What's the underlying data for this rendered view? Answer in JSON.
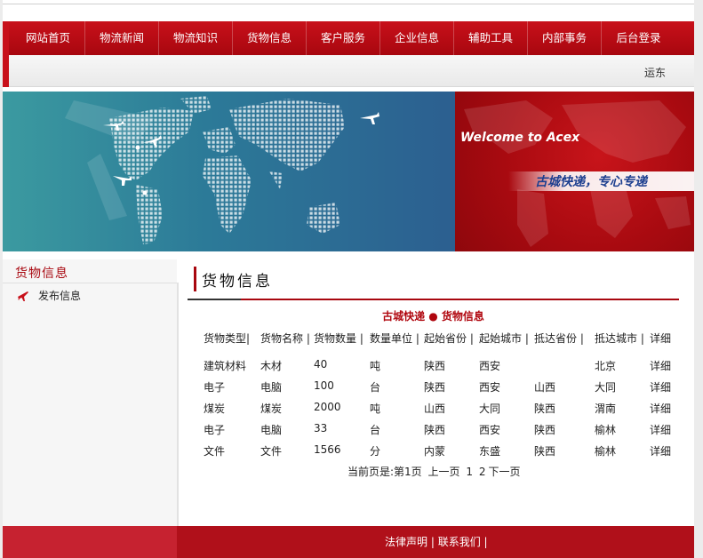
{
  "nav": {
    "items": [
      "网站首页",
      "物流新闻",
      "物流知识",
      "货物信息",
      "客户服务",
      "企业信息",
      "辅助工具",
      "内部事务",
      "后台登录"
    ]
  },
  "marquee": {
    "text": "运东"
  },
  "banner": {
    "welcome": "Welcome to  Acex",
    "slogan": "古城快递，专心专递"
  },
  "sidebar": {
    "title": "货物信息",
    "link": "发布信息"
  },
  "main": {
    "title": "货物信息",
    "caption": "古城快递 ● 货物信息",
    "headers": [
      "货物类型|",
      "货物名称 |",
      "货物数量 |",
      "数量单位 |",
      "起始省份 |",
      "起始城市 |",
      "抵达省份 |",
      "抵达城市 |",
      "详细"
    ],
    "rows": [
      [
        "建筑材料",
        "木材",
        "40",
        "吨",
        "陕西",
        "西安",
        "",
        "北京",
        "详细"
      ],
      [
        "电子",
        "电脑",
        "100",
        "台",
        "陕西",
        "西安",
        "山西",
        "大同",
        "详细"
      ],
      [
        "煤炭",
        "煤炭",
        "2000",
        "吨",
        "山西",
        "大同",
        "陕西",
        "渭南",
        "详细"
      ],
      [
        "电子",
        "电脑",
        "33",
        "台",
        "陕西",
        "西安",
        "陕西",
        "榆林",
        "详细"
      ],
      [
        "文件",
        "文件",
        "1566",
        "分",
        "内蒙",
        "东盛",
        "陕西",
        "榆林",
        "详细"
      ]
    ],
    "pager": {
      "current": "当前页是:第1页",
      "prev": "上一页",
      "page1": "1",
      "page2": "2",
      "next": "下一页"
    }
  },
  "footer": {
    "legal": "法律声明",
    "sep": " | ",
    "contact": "联系我们",
    "trail": " |"
  },
  "colors": {
    "brand_red": "#a8070f",
    "nav_red": "#c8101a",
    "slogan_blue": "#1c3e8f"
  }
}
